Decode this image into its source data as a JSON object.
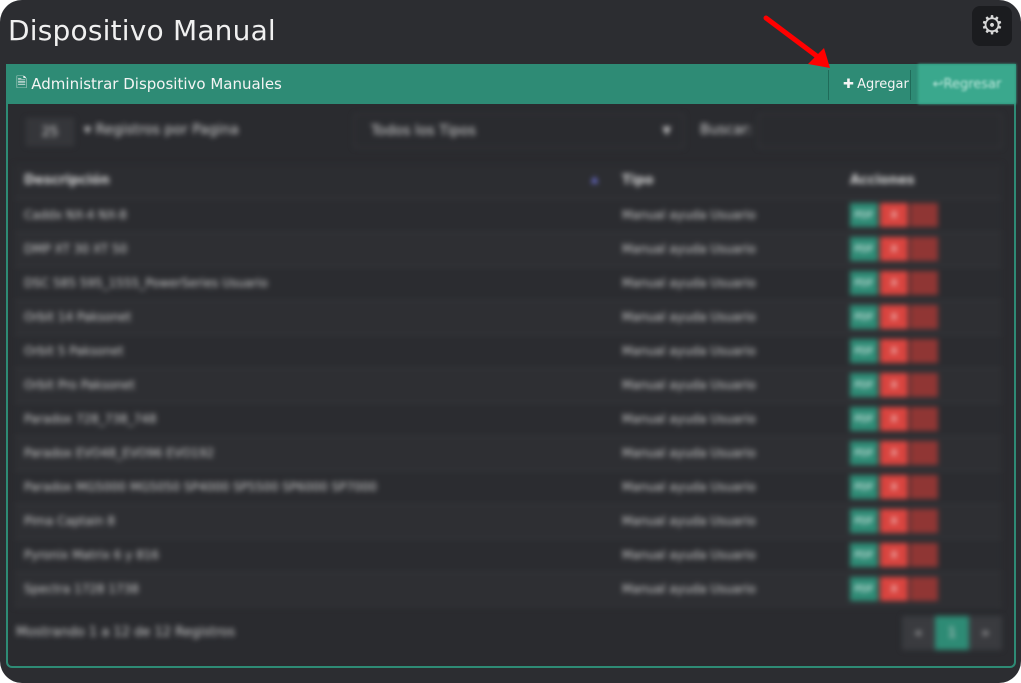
{
  "page": {
    "title": "Dispositivo Manual"
  },
  "panel": {
    "title": "Administrar Dispositivo Manuales",
    "add_label": "Agregar",
    "back_label": "Regresar"
  },
  "controls": {
    "page_size": "25",
    "page_size_label": "Registros por Pagina",
    "type_filter": "Todos los Tipos",
    "search_label": "Buscar:",
    "search_value": ""
  },
  "table": {
    "headers": [
      "Descripción",
      "Tipo",
      "Acciones"
    ],
    "rows": [
      {
        "description": "Caddx NX-4 NX-8",
        "type": "Manual ayuda Usuario"
      },
      {
        "description": "DMP XT 30 XT 50",
        "type": "Manual ayuda Usuario"
      },
      {
        "description": "DSC 585 595_1555_PowerSeries Usuario",
        "type": "Manual ayuda Usuario"
      },
      {
        "description": "Orbit 14 Paksonet",
        "type": "Manual ayuda Usuario"
      },
      {
        "description": "Orbit 5 Paksonet",
        "type": "Manual ayuda Usuario"
      },
      {
        "description": "Orbit Pro Paksonet",
        "type": "Manual ayuda Usuario"
      },
      {
        "description": "Paradox 728_738_748",
        "type": "Manual ayuda Usuario"
      },
      {
        "description": "Paradox EVO48_EVO96 EVO192",
        "type": "Manual ayuda Usuario"
      },
      {
        "description": "Paradox MG5000 MG5050 SP4000 SP5500 SP6000 SP7000",
        "type": "Manual ayuda Usuario"
      },
      {
        "description": "Pima Captain 8",
        "type": "Manual ayuda Usuario"
      },
      {
        "description": "Pyronix Matrix 6 y 816",
        "type": "Manual ayuda Usuario"
      },
      {
        "description": "Spectra 1728 1738",
        "type": "Manual ayuda Usuario"
      }
    ],
    "action_labels": {
      "pdf": "PDF",
      "delete": "X"
    }
  },
  "footer": {
    "info": "Mostrando 1 a 12 de 12 Registros",
    "pager": {
      "prev": "«",
      "current": "1",
      "next": "»"
    }
  },
  "colors": {
    "accent": "#2e8b75",
    "danger": "#d9443f",
    "annotation_arrow": "#ff0000"
  }
}
